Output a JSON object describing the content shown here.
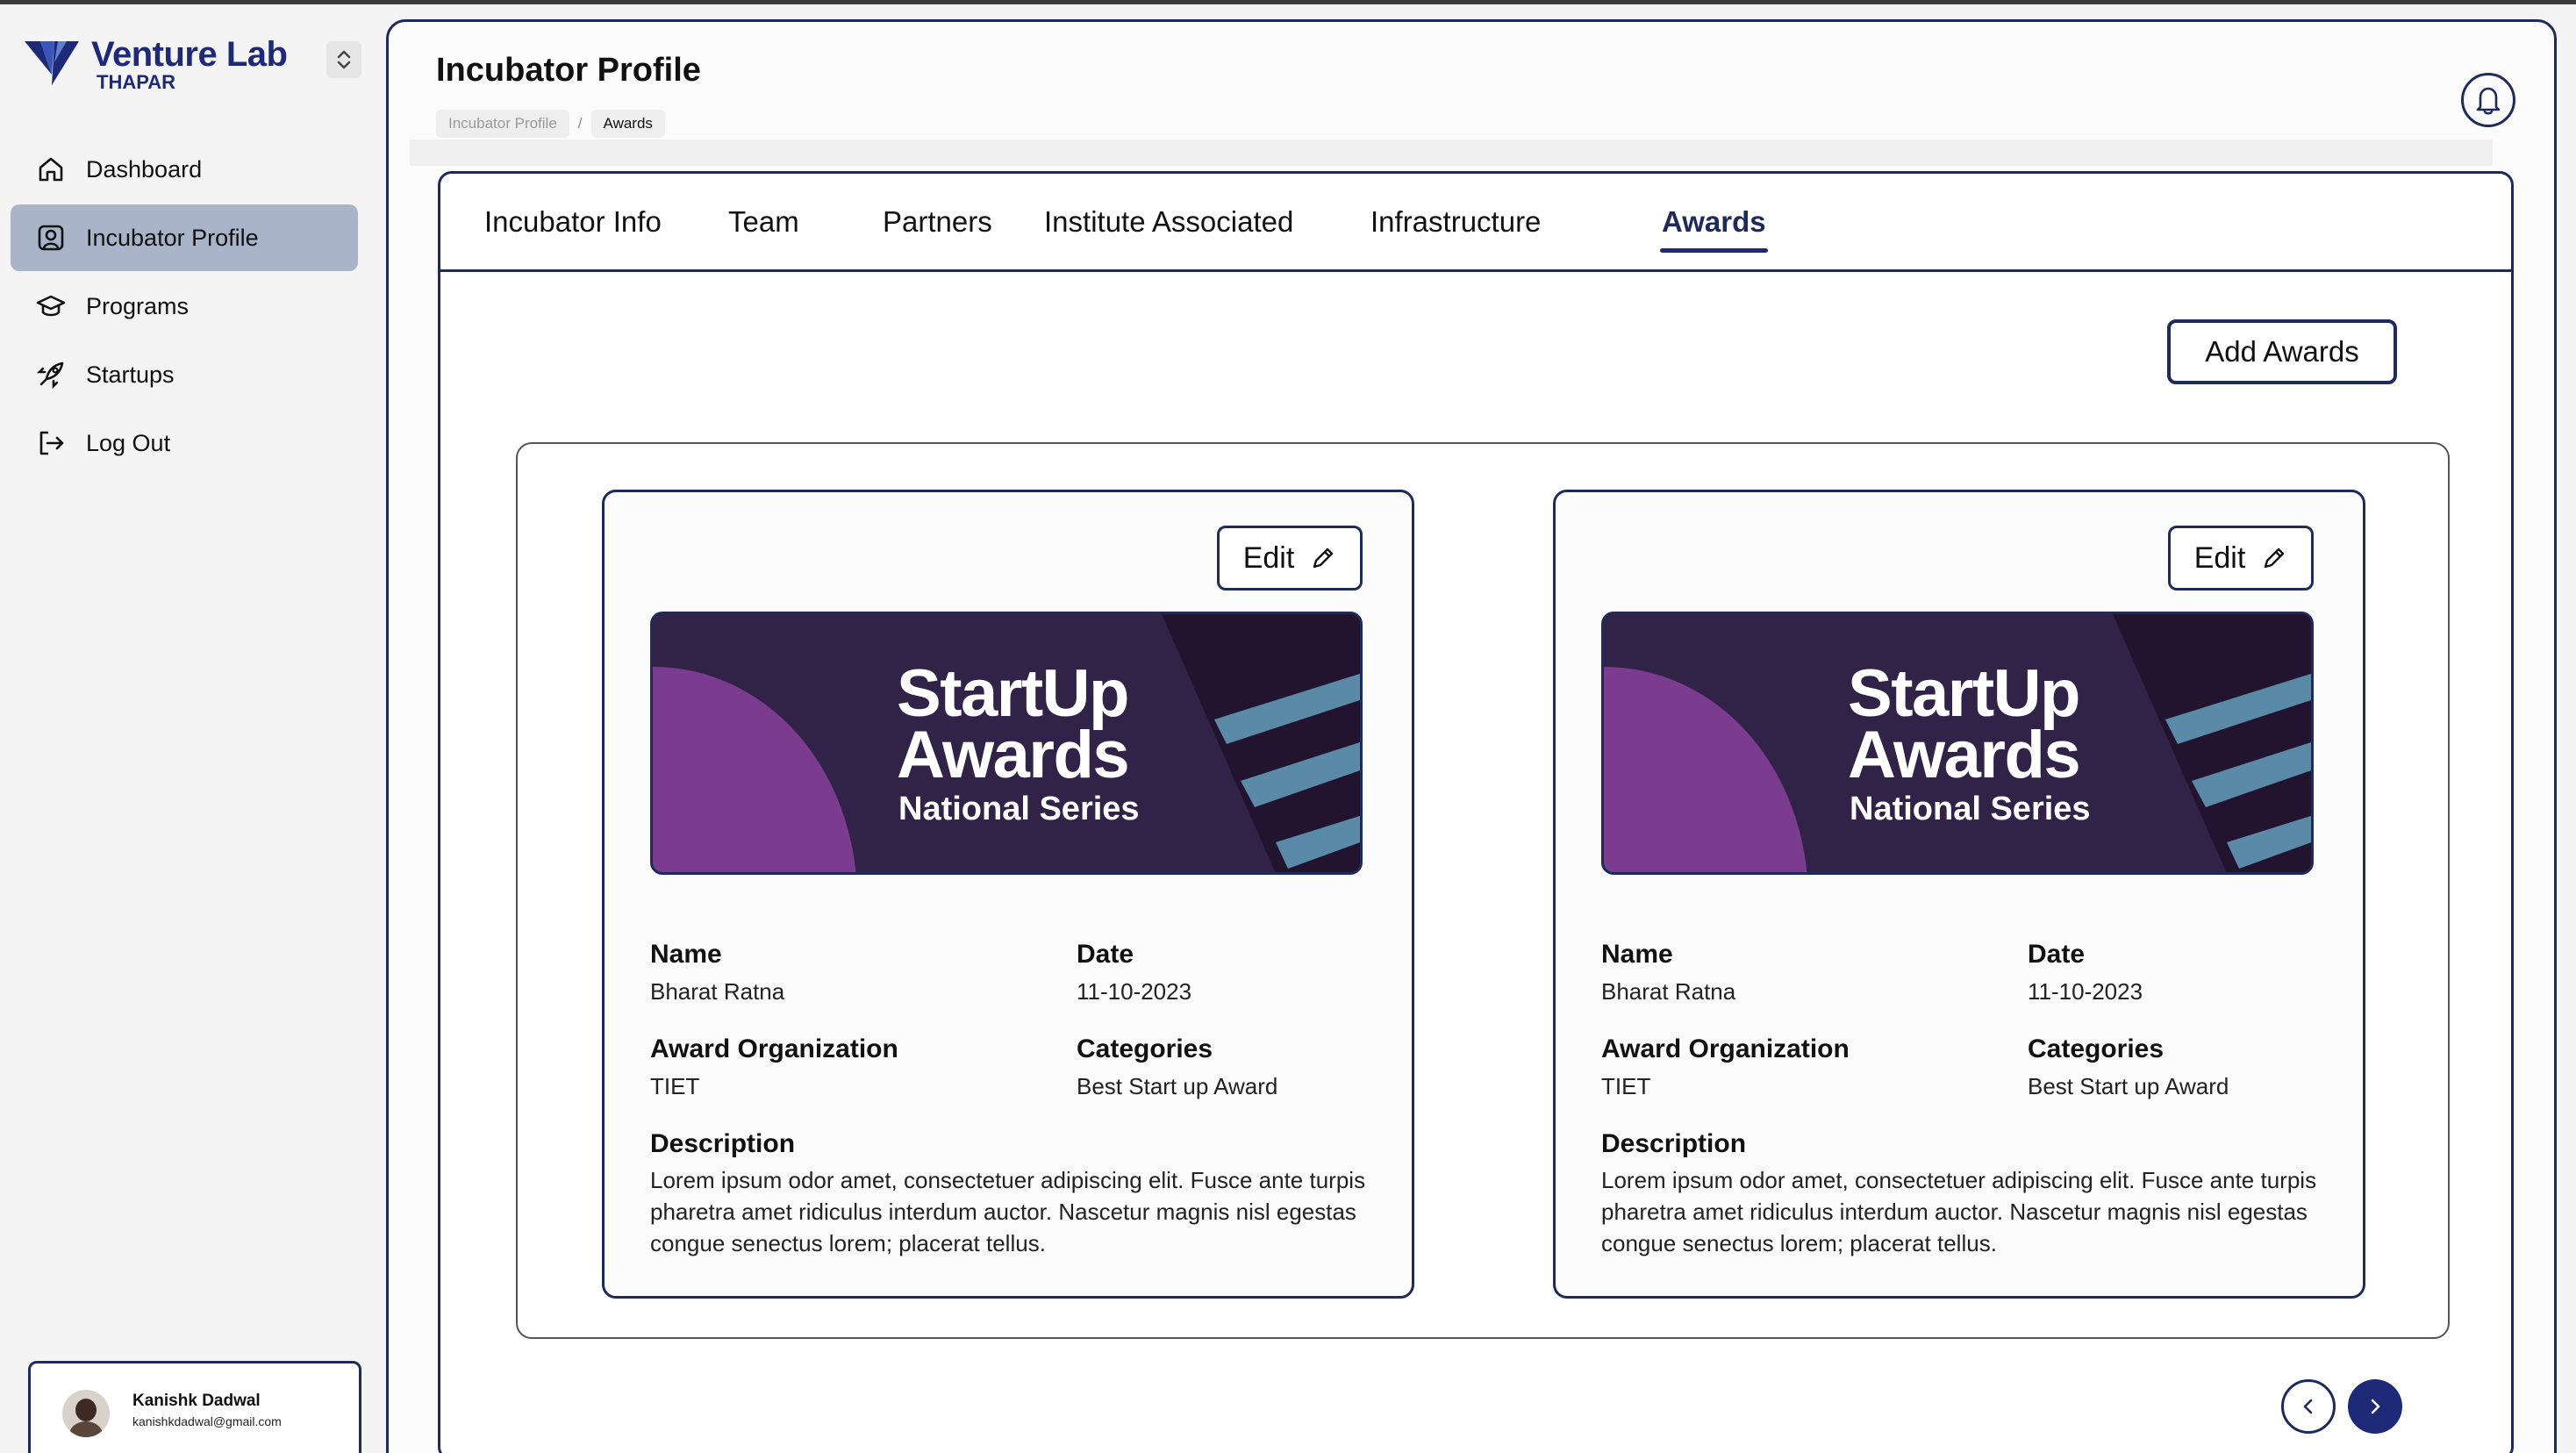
{
  "brand": {
    "title": "Venture Lab",
    "subtitle": "THAPAR"
  },
  "sidebar": {
    "items": [
      {
        "label": "Dashboard",
        "icon": "home-icon"
      },
      {
        "label": "Incubator Profile",
        "icon": "profile-icon",
        "active": true
      },
      {
        "label": "Programs",
        "icon": "graduation-cap-icon"
      },
      {
        "label": "Startups",
        "icon": "rocket-icon"
      },
      {
        "label": "Log Out",
        "icon": "logout-icon"
      }
    ]
  },
  "user": {
    "name": "Kanishk Dadwal",
    "email": "kanishkdadwal@gmail.com"
  },
  "header": {
    "title": "Incubator Profile",
    "breadcrumb": [
      "Incubator Profile",
      "/",
      "Awards"
    ]
  },
  "tabs": [
    "Incubator Info",
    "Team",
    "Partners",
    "Institute Associated",
    "Infrastructure",
    "Awards"
  ],
  "active_tab": "Awards",
  "actions": {
    "add_awards": "Add Awards",
    "edit": "Edit"
  },
  "labels": {
    "name": "Name",
    "date": "Date",
    "org": "Award Organization",
    "categories": "Categories",
    "description": "Description"
  },
  "banner": {
    "line1": "StartUp",
    "line2": "Awards",
    "line3": "National Series"
  },
  "awards": [
    {
      "name": "Bharat Ratna",
      "date": "11-10-2023",
      "org": "TIET",
      "categories": "Best Start up Award",
      "description": "Lorem ipsum odor amet, consectetuer adipiscing elit. Fusce ante turpis pharetra amet ridiculus interdum auctor. Nascetur magnis nisl egestas congue senectus lorem; placerat tellus."
    },
    {
      "name": "Bharat Ratna",
      "date": "11-10-2023",
      "org": "TIET",
      "categories": "Best Start up Award",
      "description": "Lorem ipsum odor amet, consectetuer adipiscing elit. Fusce ante turpis pharetra amet ridiculus interdum auctor. Nascetur magnis nisl egestas congue senectus lorem; placerat tellus."
    }
  ],
  "colors": {
    "primary": "#1e2a5a",
    "accent": "#1e2a78",
    "active_nav": "#a9b4c8",
    "banner_bg": "#312247",
    "banner_purple": "#7b3b8f",
    "banner_stripe": "#5a8aa8"
  }
}
